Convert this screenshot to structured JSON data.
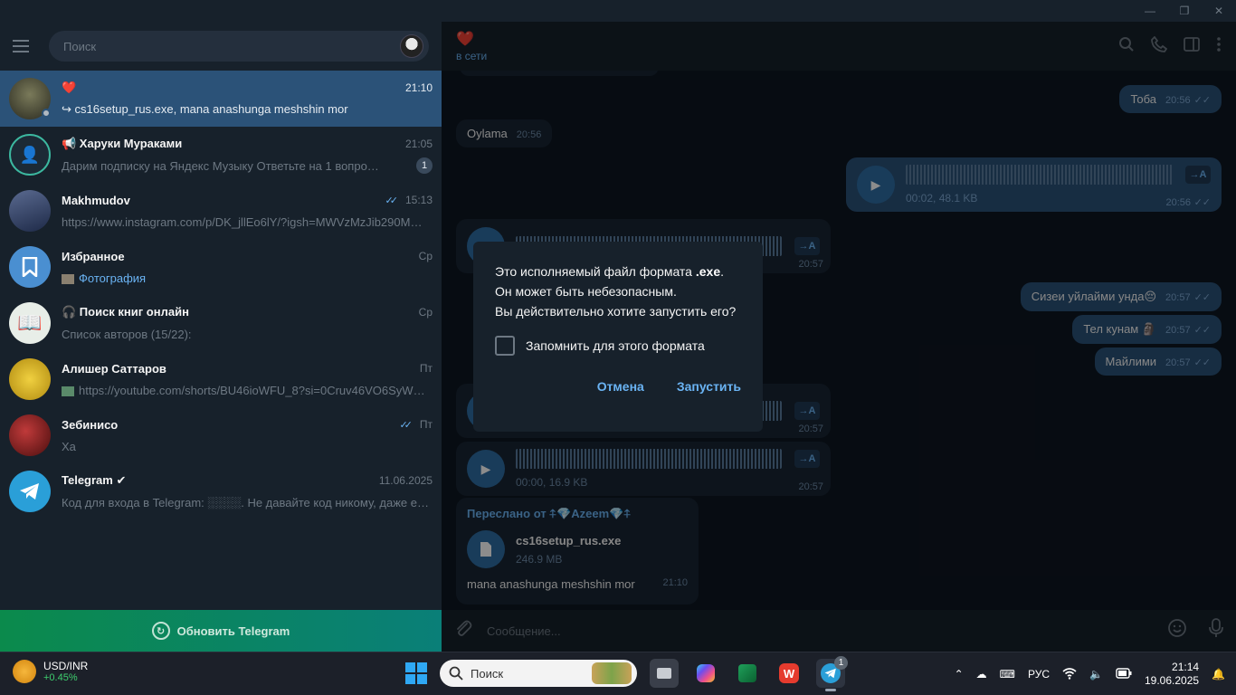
{
  "window": {
    "minimize_glyph": "—",
    "restore_glyph": "❐",
    "close_glyph": "✕"
  },
  "sidebar": {
    "search_placeholder": "Поиск",
    "chats": [
      {
        "name": "❤️",
        "time": "21:10",
        "preview": "↪ cs16setup_rus.exe, mana anashunga meshshin mor",
        "avatar_color": "#3a4a3a",
        "active": true
      },
      {
        "name": "📢 Харуки Мураками",
        "time": "21:05",
        "preview": "Дарим подписку на Яндекс Музыку  Ответьте на 1 вопро…",
        "badge": "1",
        "avatar_color": "#2d3c4a"
      },
      {
        "name": "Makhmudov",
        "time": "15:13",
        "ticks": "✓✓",
        "preview": "https://www.instagram.com/p/DK_jllEo6lY/?igsh=MWVzMzJib290M…",
        "avatar_color": "#3b4a6b"
      },
      {
        "name": "Избранное",
        "time": "Ср",
        "preview_highlight": "Фотография",
        "avatar_color": "#4a8fd1"
      },
      {
        "name": "🎧 Поиск книг онлайн",
        "time": "Ср",
        "preview": "Список авторов (15/22):",
        "avatar_color": "#2a8a6a"
      },
      {
        "name": "Алишер Саттаров",
        "time": "Пт",
        "preview": "https://youtube.com/shorts/BU46ioWFU_8?si=0Cruv46VO6SyW…",
        "avatar_color": "#c8b030"
      },
      {
        "name": "Зебинисо",
        "time": "Пт",
        "ticks": "✓✓",
        "preview": "Ха",
        "avatar_color": "#8a2a2a"
      },
      {
        "name": "Telegram ✔",
        "time": "11.06.2025",
        "preview": "Код для входа в Telegram: ░░░░. Не давайте код никому, даже ес…",
        "avatar_color": "#2a9fd8"
      }
    ],
    "update_label": "Обновить Telegram"
  },
  "header": {
    "name": "❤️",
    "status": "в сети"
  },
  "messages": {
    "m1_text": "Тоба",
    "m1_time": "20:56",
    "m2_text": "Oylama",
    "m2_time": "20:56",
    "m3_info": "00:02, 48.1 KB",
    "m3_time": "20:56",
    "m4_time": "20:57",
    "m5_text": "Сизеи уйлайми унда😔",
    "m5_time": "20:57",
    "m6_text": "Тел кунам 🗿",
    "m6_time": "20:57",
    "m7_text": "Майлими",
    "m7_time": "20:57",
    "m8_time": "20:57",
    "m9_info": "00:00, 16.9 KB",
    "m9_time": "20:57",
    "fwd_label": "Переслано от ⍏💎Azeem💎⍏",
    "file_name": "cs16setup_rus.exe",
    "file_size": "246.9 MB",
    "fwd_caption": "mana anashunga meshshin mor",
    "fwd_time": "21:10",
    "transcribe_label": "→A"
  },
  "dialog": {
    "line1_pre": "Это исполняемый файл формата ",
    "line1_ext": ".exe",
    "line1_post": ".",
    "line2": "Он может быть небезопасным.",
    "line3": "Вы действительно хотите запустить его?",
    "remember_label": "Запомнить для этого формата",
    "cancel_label": "Отмена",
    "run_label": "Запустить"
  },
  "composer": {
    "placeholder": "Сообщение..."
  },
  "taskbar": {
    "widget_title": "USD/INR",
    "widget_value": "+0.45%",
    "search_label": "Поиск",
    "telegram_badge": "1",
    "lang": "РУС",
    "time": "21:14",
    "date": "19.06.2025"
  }
}
